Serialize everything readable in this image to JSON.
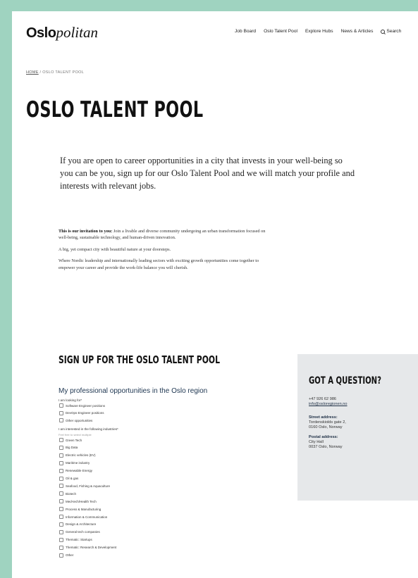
{
  "header": {
    "logo_bold": "Oslo",
    "logo_italic": "politan",
    "nav": [
      "Job Board",
      "Oslo Talent Pool",
      "Explore Hubs",
      "News & Articles"
    ],
    "search_label": "Search"
  },
  "breadcrumb": {
    "home": "HOME",
    "separator": " / ",
    "current": "OSLO TALENT POOL"
  },
  "page_title": "OSLO TALENT POOL",
  "intro": "If you are open to career opportunities in a city that invests in your well-being so you can be you, sign up for our Oslo Talent Pool and we will match your profile and interests with relevant jobs.",
  "body": {
    "invite_bold": "This is our invitation to you:",
    "invite_text": " Join a livable and diverse community undergoing an urban transformation focused on well-being, sustainable technology, and human-driven innovation.",
    "p2": "A big, yet compact city with beautiful nature at your doorsteps.",
    "p3": "Where Nordic leadership and internationally leading sectors with exciting growth opportunities come together to empower your career and provide the work-life balance you will cherish."
  },
  "signup": {
    "title": "SIGN UP FOR THE OSLO TALENT POOL",
    "subtitle": "My professional opportunities in the Oslo region",
    "looking_label": "I am looking for*",
    "looking_options": [
      "Software Engineer positions",
      "DevOps Engineer positions",
      "Other opportunities"
    ],
    "industries_label": "I am interested in the following industries*",
    "industries_hint": "Feel free to select multiple",
    "industries": [
      "Green Tech",
      "Big Data",
      "Electric vehicles (EV)",
      "Maritime industry",
      "Renewable Energy",
      "Oil & gas",
      "Seafood, Fishing & Aquaculture",
      "Biotech",
      "Med-tech/Health Tech",
      "Process & Manufacturing",
      "Information & Communication",
      "Design & Architecture",
      "General tech companies",
      "Thematic: Startups",
      "Thematic: Research & Development",
      "Other"
    ]
  },
  "contact": {
    "title": "GOT A QUESTION?",
    "phone": "+47 926 62 986",
    "email": "info@osloregionen.no",
    "street_label": "Street address:",
    "street_1": "Tordenskiolds gate 2,",
    "street_2": "0160 Oslo, Norway",
    "postal_label": "Postal address:",
    "postal_1": "City Hall",
    "postal_2": "0037 Oslo, Norway"
  },
  "colors": {
    "frame": "#9fd3c0",
    "contact_bg": "#e6e8ea",
    "heading_blue": "#1d3550"
  }
}
